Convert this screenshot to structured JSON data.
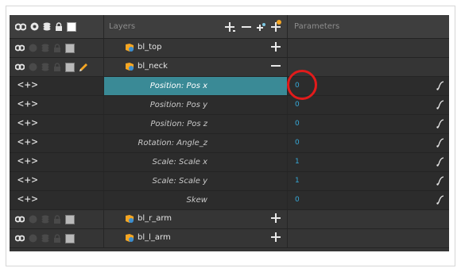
{
  "header": {
    "layers_label": "Layers",
    "parameters_label": "Parameters"
  },
  "layers_top": [
    {
      "name": "bl_top",
      "toggle": "+"
    },
    {
      "name": "bl_neck",
      "toggle": "−"
    }
  ],
  "params": [
    {
      "arrows": "<+>",
      "name": "Position: Pos x",
      "value": "0"
    },
    {
      "arrows": "<+>",
      "name": "Position: Pos y",
      "value": "0"
    },
    {
      "arrows": "<+>",
      "name": "Position: Pos z",
      "value": "0"
    },
    {
      "arrows": "<+>",
      "name": "Rotation: Angle_z",
      "value": "0"
    },
    {
      "arrows": "<+>",
      "name": "Scale: Scale x",
      "value": "1"
    },
    {
      "arrows": "<+>",
      "name": "Scale: Scale y",
      "value": "1"
    },
    {
      "arrows": "<+>",
      "name": "Skew",
      "value": "0"
    }
  ],
  "layers_bottom": [
    {
      "name": "bl_r_arm",
      "toggle": "+"
    },
    {
      "name": "bl_l_arm",
      "toggle": "+"
    }
  ],
  "colors": {
    "panel_bg": "#353535",
    "selected": "#3a8a96",
    "value_blue": "#37a9d8",
    "highlight_red": "#e21b1b",
    "peg_orange": "#f5a623"
  }
}
